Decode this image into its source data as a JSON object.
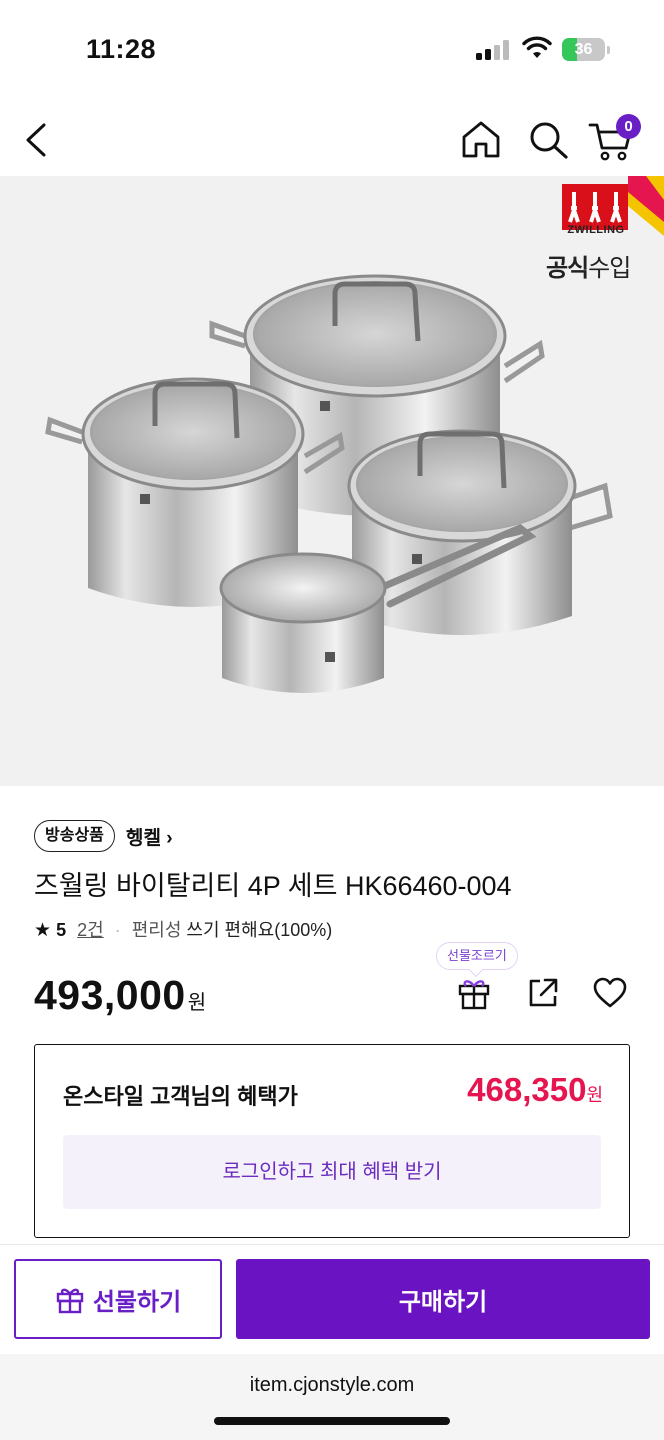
{
  "status_bar": {
    "time": "11:28",
    "battery_level": "36",
    "battery_fraction": 0.36
  },
  "top_nav": {
    "back_icon": "chevron-left-icon",
    "home_icon": "home-icon",
    "search_icon": "search-icon",
    "cart_icon": "cart-icon",
    "cart_count": "0"
  },
  "hero": {
    "brand_text": "ZWILLING",
    "official_import_a": "공식",
    "official_import_b": "수입"
  },
  "product": {
    "broadcast_badge": "방송상품",
    "brand_link": "헹켈 ›",
    "title": "즈월링 바이탈리티 4P 세트 HK66460-004",
    "rating": {
      "star": "★",
      "score": "5",
      "review_count": "2건",
      "separator": "·",
      "keyword": "편리성",
      "keyword_value": "쓰기 편해요(100%)"
    },
    "price": "493,000",
    "price_unit": "원",
    "gift_tooltip": "선물조르기"
  },
  "benefit": {
    "label": "온스타일 고객님의 혜택가",
    "price": "468,350",
    "price_unit": "원",
    "login_button": "로그인하고 최대 혜택 받기"
  },
  "bottom_bar": {
    "gift_button": "선물하기",
    "buy_button": "구매하기"
  },
  "browser": {
    "url": "item.cjonstyle.com"
  },
  "colors": {
    "accent": "#6a13c3",
    "benefit_price": "#e5154f",
    "cart_badge": "#6a1fc6"
  }
}
